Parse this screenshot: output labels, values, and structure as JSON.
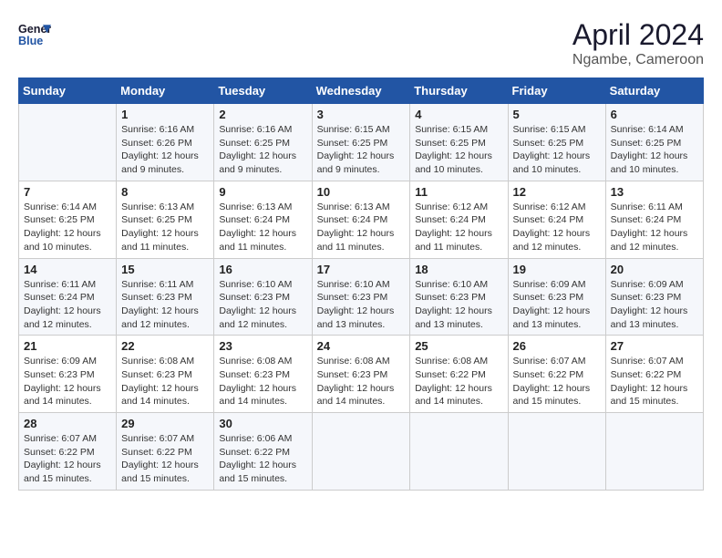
{
  "header": {
    "logo_line1": "General",
    "logo_line2": "Blue",
    "month": "April 2024",
    "location": "Ngambe, Cameroon"
  },
  "columns": [
    "Sunday",
    "Monday",
    "Tuesday",
    "Wednesday",
    "Thursday",
    "Friday",
    "Saturday"
  ],
  "weeks": [
    [
      {
        "day": "",
        "sunrise": "",
        "sunset": "",
        "daylight": ""
      },
      {
        "day": "1",
        "sunrise": "Sunrise: 6:16 AM",
        "sunset": "Sunset: 6:26 PM",
        "daylight": "Daylight: 12 hours and 9 minutes."
      },
      {
        "day": "2",
        "sunrise": "Sunrise: 6:16 AM",
        "sunset": "Sunset: 6:25 PM",
        "daylight": "Daylight: 12 hours and 9 minutes."
      },
      {
        "day": "3",
        "sunrise": "Sunrise: 6:15 AM",
        "sunset": "Sunset: 6:25 PM",
        "daylight": "Daylight: 12 hours and 9 minutes."
      },
      {
        "day": "4",
        "sunrise": "Sunrise: 6:15 AM",
        "sunset": "Sunset: 6:25 PM",
        "daylight": "Daylight: 12 hours and 10 minutes."
      },
      {
        "day": "5",
        "sunrise": "Sunrise: 6:15 AM",
        "sunset": "Sunset: 6:25 PM",
        "daylight": "Daylight: 12 hours and 10 minutes."
      },
      {
        "day": "6",
        "sunrise": "Sunrise: 6:14 AM",
        "sunset": "Sunset: 6:25 PM",
        "daylight": "Daylight: 12 hours and 10 minutes."
      }
    ],
    [
      {
        "day": "7",
        "sunrise": "Sunrise: 6:14 AM",
        "sunset": "Sunset: 6:25 PM",
        "daylight": "Daylight: 12 hours and 10 minutes."
      },
      {
        "day": "8",
        "sunrise": "Sunrise: 6:13 AM",
        "sunset": "Sunset: 6:25 PM",
        "daylight": "Daylight: 12 hours and 11 minutes."
      },
      {
        "day": "9",
        "sunrise": "Sunrise: 6:13 AM",
        "sunset": "Sunset: 6:24 PM",
        "daylight": "Daylight: 12 hours and 11 minutes."
      },
      {
        "day": "10",
        "sunrise": "Sunrise: 6:13 AM",
        "sunset": "Sunset: 6:24 PM",
        "daylight": "Daylight: 12 hours and 11 minutes."
      },
      {
        "day": "11",
        "sunrise": "Sunrise: 6:12 AM",
        "sunset": "Sunset: 6:24 PM",
        "daylight": "Daylight: 12 hours and 11 minutes."
      },
      {
        "day": "12",
        "sunrise": "Sunrise: 6:12 AM",
        "sunset": "Sunset: 6:24 PM",
        "daylight": "Daylight: 12 hours and 12 minutes."
      },
      {
        "day": "13",
        "sunrise": "Sunrise: 6:11 AM",
        "sunset": "Sunset: 6:24 PM",
        "daylight": "Daylight: 12 hours and 12 minutes."
      }
    ],
    [
      {
        "day": "14",
        "sunrise": "Sunrise: 6:11 AM",
        "sunset": "Sunset: 6:24 PM",
        "daylight": "Daylight: 12 hours and 12 minutes."
      },
      {
        "day": "15",
        "sunrise": "Sunrise: 6:11 AM",
        "sunset": "Sunset: 6:23 PM",
        "daylight": "Daylight: 12 hours and 12 minutes."
      },
      {
        "day": "16",
        "sunrise": "Sunrise: 6:10 AM",
        "sunset": "Sunset: 6:23 PM",
        "daylight": "Daylight: 12 hours and 12 minutes."
      },
      {
        "day": "17",
        "sunrise": "Sunrise: 6:10 AM",
        "sunset": "Sunset: 6:23 PM",
        "daylight": "Daylight: 12 hours and 13 minutes."
      },
      {
        "day": "18",
        "sunrise": "Sunrise: 6:10 AM",
        "sunset": "Sunset: 6:23 PM",
        "daylight": "Daylight: 12 hours and 13 minutes."
      },
      {
        "day": "19",
        "sunrise": "Sunrise: 6:09 AM",
        "sunset": "Sunset: 6:23 PM",
        "daylight": "Daylight: 12 hours and 13 minutes."
      },
      {
        "day": "20",
        "sunrise": "Sunrise: 6:09 AM",
        "sunset": "Sunset: 6:23 PM",
        "daylight": "Daylight: 12 hours and 13 minutes."
      }
    ],
    [
      {
        "day": "21",
        "sunrise": "Sunrise: 6:09 AM",
        "sunset": "Sunset: 6:23 PM",
        "daylight": "Daylight: 12 hours and 14 minutes."
      },
      {
        "day": "22",
        "sunrise": "Sunrise: 6:08 AM",
        "sunset": "Sunset: 6:23 PM",
        "daylight": "Daylight: 12 hours and 14 minutes."
      },
      {
        "day": "23",
        "sunrise": "Sunrise: 6:08 AM",
        "sunset": "Sunset: 6:23 PM",
        "daylight": "Daylight: 12 hours and 14 minutes."
      },
      {
        "day": "24",
        "sunrise": "Sunrise: 6:08 AM",
        "sunset": "Sunset: 6:23 PM",
        "daylight": "Daylight: 12 hours and 14 minutes."
      },
      {
        "day": "25",
        "sunrise": "Sunrise: 6:08 AM",
        "sunset": "Sunset: 6:22 PM",
        "daylight": "Daylight: 12 hours and 14 minutes."
      },
      {
        "day": "26",
        "sunrise": "Sunrise: 6:07 AM",
        "sunset": "Sunset: 6:22 PM",
        "daylight": "Daylight: 12 hours and 15 minutes."
      },
      {
        "day": "27",
        "sunrise": "Sunrise: 6:07 AM",
        "sunset": "Sunset: 6:22 PM",
        "daylight": "Daylight: 12 hours and 15 minutes."
      }
    ],
    [
      {
        "day": "28",
        "sunrise": "Sunrise: 6:07 AM",
        "sunset": "Sunset: 6:22 PM",
        "daylight": "Daylight: 12 hours and 15 minutes."
      },
      {
        "day": "29",
        "sunrise": "Sunrise: 6:07 AM",
        "sunset": "Sunset: 6:22 PM",
        "daylight": "Daylight: 12 hours and 15 minutes."
      },
      {
        "day": "30",
        "sunrise": "Sunrise: 6:06 AM",
        "sunset": "Sunset: 6:22 PM",
        "daylight": "Daylight: 12 hours and 15 minutes."
      },
      {
        "day": "",
        "sunrise": "",
        "sunset": "",
        "daylight": ""
      },
      {
        "day": "",
        "sunrise": "",
        "sunset": "",
        "daylight": ""
      },
      {
        "day": "",
        "sunrise": "",
        "sunset": "",
        "daylight": ""
      },
      {
        "day": "",
        "sunrise": "",
        "sunset": "",
        "daylight": ""
      }
    ]
  ]
}
